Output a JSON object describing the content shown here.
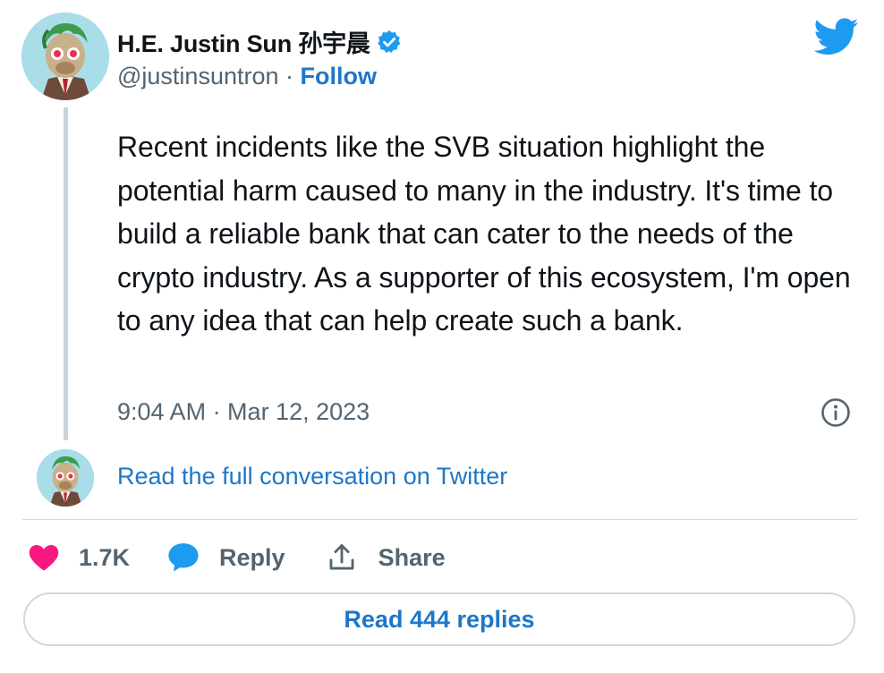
{
  "author": {
    "display_name": "H.E. Justin Sun 孙宇晨",
    "handle": "@justinsuntron",
    "separator": " · ",
    "follow_label": "Follow"
  },
  "tweet": {
    "text": "Recent incidents like the SVB situation highlight the potential harm caused to many in the industry. It's time to build a reliable bank that can cater to the needs of the crypto industry. As a supporter of this ecosystem, I'm open to any idea that can help create such a bank.",
    "timestamp": "9:04 AM · Mar 12, 2023"
  },
  "conversation": {
    "link_label": "Read the full conversation on Twitter"
  },
  "actions": {
    "like_count": "1.7K",
    "reply_label": "Reply",
    "share_label": "Share"
  },
  "footer": {
    "read_replies_label": "Read 444 replies"
  },
  "icons": {
    "brand": "twitter-bird-icon",
    "verified": "verified-badge-icon",
    "info": "info-icon",
    "like": "heart-icon",
    "reply": "speech-bubble-icon",
    "share": "share-upload-icon"
  },
  "colors": {
    "link_blue": "#1d77c9",
    "twitter_blue": "#1d9bf0",
    "heart_pink": "#f91880",
    "muted_text": "#536471",
    "avatar_bg": "#a9dde8"
  }
}
